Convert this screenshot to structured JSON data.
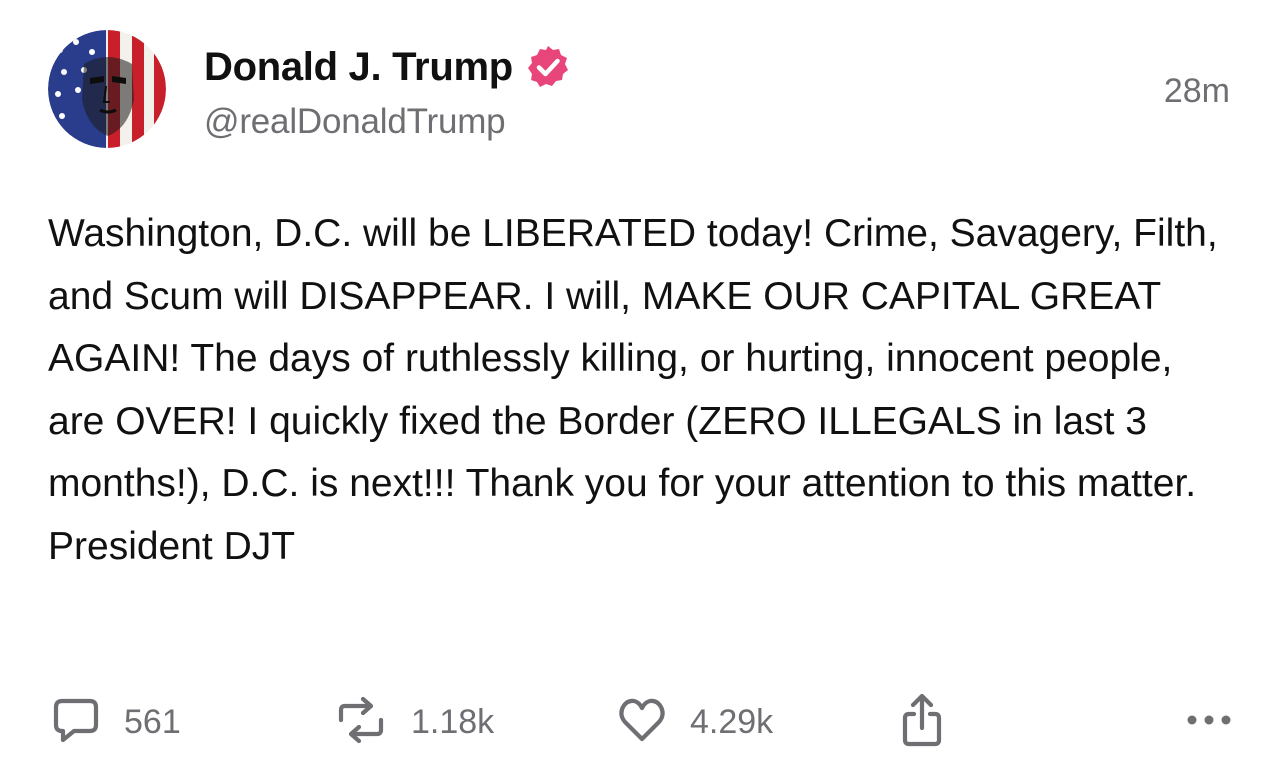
{
  "post": {
    "author": {
      "display_name": "Donald J. Trump",
      "handle": "@realDonaldTrump",
      "verified": true,
      "verified_icon": "verified-badge-icon",
      "verified_color": "#e8467a"
    },
    "timestamp": "28m",
    "text": "Washington, D.C. will be LIBERATED today! Crime, Savagery, Filth, and Scum will DISAPPEAR. I will, MAKE OUR CAPITAL GREAT AGAIN! The days of ruthlessly killing, or hurting, innocent people, are OVER! I quickly fixed the Border (ZERO ILLEGALS in last 3 months!), D.C. is next!!! Thank you for your attention to this matter. President DJT",
    "actions": {
      "replies": {
        "icon": "reply-bubble-icon",
        "count": "561"
      },
      "reposts": {
        "icon": "repost-icon",
        "count": "1.18k"
      },
      "likes": {
        "icon": "heart-icon",
        "count": "4.29k"
      },
      "share": {
        "icon": "share-icon"
      },
      "more": {
        "icon": "more-dots-icon"
      }
    }
  },
  "colors": {
    "text": "#111111",
    "secondary": "#6e6e73",
    "background": "#ffffff"
  }
}
